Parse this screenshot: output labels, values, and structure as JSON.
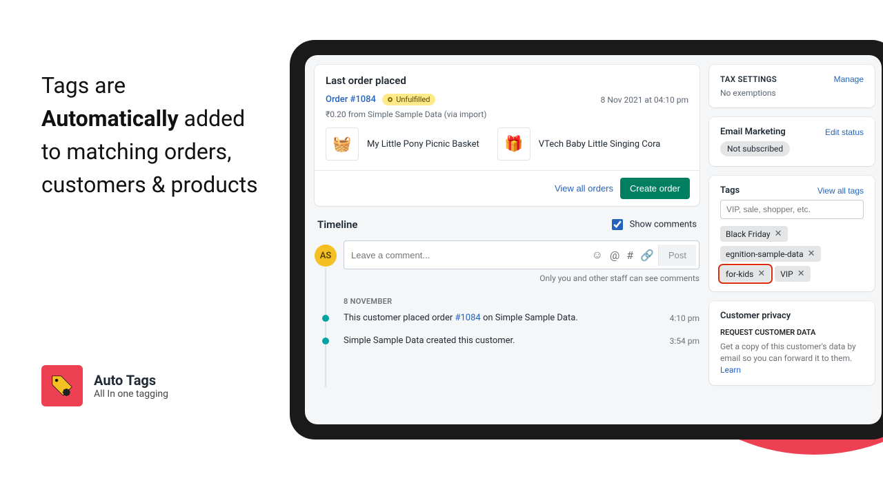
{
  "headline": {
    "l1": "Tags are",
    "l2": "Automatically",
    "l3": "added to matching orders, customers & products"
  },
  "app": {
    "name": "Auto Tags",
    "tagline": "All In one tagging"
  },
  "order_card": {
    "title": "Last order placed",
    "order_link": "Order #1084",
    "status": "Unfulfilled",
    "date": "8 Nov 2021 at 04:10 pm",
    "summary": "₹0.20 from Simple Sample Data (via import)",
    "products": [
      {
        "name": "My Little Pony Picnic Basket",
        "emoji": "🧺"
      },
      {
        "name": "VTech Baby Little Singing Cora",
        "emoji": "🎁"
      }
    ],
    "view_all": "View all orders",
    "create": "Create order"
  },
  "timeline": {
    "title": "Timeline",
    "show_comments": "Show comments",
    "placeholder": "Leave a comment...",
    "post": "Post",
    "hint": "Only you and other staff can see comments",
    "day": "8 NOVEMBER",
    "avatar": "AS",
    "items": [
      {
        "pre": "This customer placed order ",
        "link": "#1084",
        "post": " on Simple Sample Data.",
        "time": "4:10 pm"
      },
      {
        "pre": "Simple Sample Data created this customer.",
        "link": "",
        "post": "",
        "time": "3:54 pm"
      }
    ]
  },
  "tax": {
    "title": "TAX SETTINGS",
    "manage": "Manage",
    "value": "No exemptions"
  },
  "email": {
    "title": "Email Marketing",
    "edit": "Edit status",
    "value": "Not subscribed"
  },
  "tags": {
    "title": "Tags",
    "view_all": "View all tags",
    "placeholder": "VIP, sale, shopper, etc.",
    "items": [
      "Black Friday",
      "egnition-sample-data",
      "for-kids",
      "VIP"
    ],
    "highlight": "for-kids"
  },
  "privacy": {
    "title": "Customer privacy",
    "sub": "REQUEST CUSTOMER DATA",
    "text": "Get a copy of this customer's data by email so you can forward it to them. ",
    "learn": "Learn"
  }
}
